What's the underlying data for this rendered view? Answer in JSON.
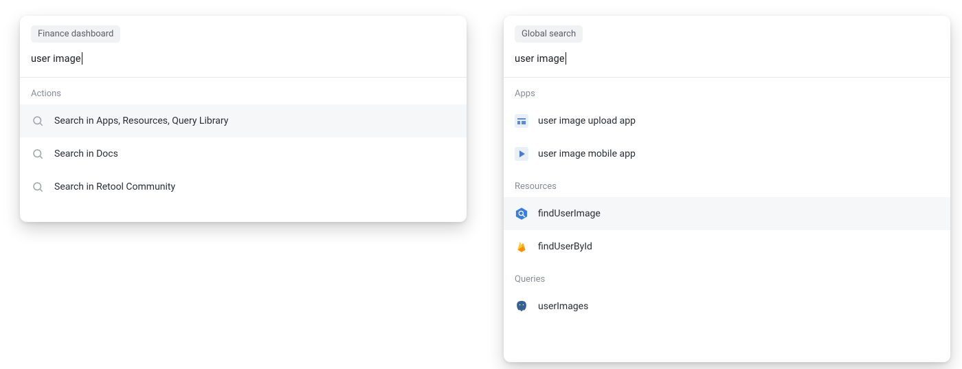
{
  "panels": {
    "left": {
      "context_tag": "Finance dashboard",
      "search_value": "user image",
      "sections": [
        {
          "label": "Actions",
          "items": [
            {
              "icon": "search",
              "label": "Search in Apps, Resources, Query Library",
              "highlighted": true
            },
            {
              "icon": "search",
              "label": "Search in Docs",
              "highlighted": false
            },
            {
              "icon": "search",
              "label": "Search in Retool Community",
              "highlighted": false
            }
          ]
        }
      ]
    },
    "right": {
      "context_tag": "Global search",
      "search_value": "user image",
      "sections": [
        {
          "label": "Apps",
          "items": [
            {
              "icon": "app-grid",
              "label": "user image upload app",
              "highlighted": false
            },
            {
              "icon": "app-play",
              "label": "user image mobile app",
              "highlighted": false
            }
          ]
        },
        {
          "label": "Resources",
          "items": [
            {
              "icon": "bigquery",
              "label": "findUserImage",
              "highlighted": true
            },
            {
              "icon": "firebase",
              "label": "findUserById",
              "highlighted": false
            }
          ]
        },
        {
          "label": "Queries",
          "items": [
            {
              "icon": "postgres",
              "label": "userImages",
              "highlighted": false
            }
          ]
        }
      ]
    }
  }
}
